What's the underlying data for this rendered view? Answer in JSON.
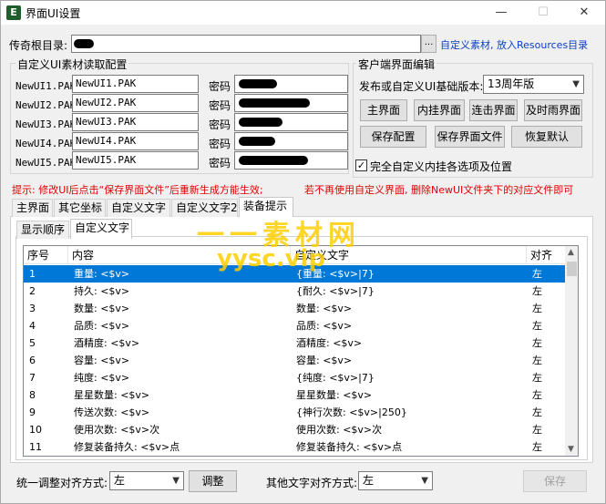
{
  "window": {
    "title": "界面UI设置",
    "icon_glyph": "E",
    "controls": {
      "minimize": "—",
      "maximize": "☐",
      "close": "✕"
    }
  },
  "root_dir": {
    "label": "传奇根目录:",
    "browse_label": "...",
    "link": "自定义素材, 放入Resources目录"
  },
  "pak_group": {
    "title": "自定义UI素材读取配置",
    "password_label": "密码",
    "rows": [
      {
        "label": "NewUI1.PAK",
        "value": "NewUI1.PAK"
      },
      {
        "label": "NewUI2.PAK",
        "value": "NewUI2.PAK"
      },
      {
        "label": "NewUI3.PAK",
        "value": "NewUI3.PAK"
      },
      {
        "label": "NewUI4.PAK",
        "value": "NewUI4.PAK"
      },
      {
        "label": "NewUI5.PAK",
        "value": "NewUI5.PAK"
      }
    ]
  },
  "client_group": {
    "title": "客户端界面编辑",
    "version_label": "发布或自定义UI基础版本:",
    "version_value": "13周年版",
    "buttons": [
      "主界面",
      "内挂界面",
      "连击界面",
      "及时雨界面",
      "保存配置",
      "保存界面文件",
      "恢复默认"
    ],
    "checkbox_label": "完全自定义内挂各选项及位置",
    "checkbox_checked": true
  },
  "hint": {
    "left": "提示: 修改UI后点击“保存界面文件”后重新生成方能生效;",
    "right": "若不再使用自定义界面, 删除NewUI文件夹下的对应文件即可"
  },
  "tabs": [
    "主界面",
    "其它坐标",
    "自定义文字",
    "自定义文字2",
    "装备提示"
  ],
  "active_tab": 4,
  "subtabs": [
    "显示顺序",
    "自定义文字"
  ],
  "active_subtab": 1,
  "watermark": {
    "line1": "一一素材网",
    "line2": "yysc.vip"
  },
  "table": {
    "headers": [
      "序号",
      "内容",
      "自定义文字",
      "对齐"
    ],
    "rows": [
      {
        "no": "1",
        "content": "重量: <$v>",
        "custom": "{重量: <$v>|7}",
        "align": "左",
        "selected": true
      },
      {
        "no": "2",
        "content": "持久: <$v>",
        "custom": "{耐久: <$v>|7}",
        "align": "左"
      },
      {
        "no": "3",
        "content": "数量: <$v>",
        "custom": "数量: <$v>",
        "align": "左"
      },
      {
        "no": "4",
        "content": "品质: <$v>",
        "custom": "品质: <$v>",
        "align": "左"
      },
      {
        "no": "5",
        "content": "酒精度: <$v>",
        "custom": "酒精度: <$v>",
        "align": "左"
      },
      {
        "no": "6",
        "content": "容量: <$v>",
        "custom": "容量: <$v>",
        "align": "左"
      },
      {
        "no": "7",
        "content": "纯度: <$v>",
        "custom": "{纯度: <$v>|7}",
        "align": "左"
      },
      {
        "no": "8",
        "content": "星星数量: <$v>",
        "custom": "星星数量: <$v>",
        "align": "左"
      },
      {
        "no": "9",
        "content": "传送次数: <$v>",
        "custom": "{神行次数: <$v>|250}",
        "align": "左"
      },
      {
        "no": "10",
        "content": "使用次数: <$v>次",
        "custom": "使用次数: <$v>次",
        "align": "左"
      },
      {
        "no": "11",
        "content": "修复装备持久: <$v>点",
        "custom": "修复装备持久: <$v>点",
        "align": "左"
      }
    ]
  },
  "footer": {
    "align_label": "统一调整对齐方式:",
    "align_value": "左",
    "adjust_button": "调整",
    "other_align_label": "其他文字对齐方式:",
    "other_align_value": "左",
    "save_button": "保存"
  },
  "icons": {
    "dropdown": "▼",
    "scroll_up": "▲",
    "scroll_down": "▼",
    "check": "✓"
  }
}
